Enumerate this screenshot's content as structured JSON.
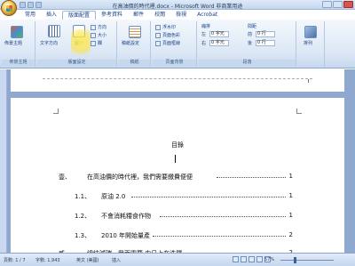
{
  "window": {
    "title": "在高油價的時代裡.docx - Microsoft Word 非商業用途"
  },
  "tabs": [
    {
      "label": "常用"
    },
    {
      "label": "插入"
    },
    {
      "label": "版面配置"
    },
    {
      "label": "參考資料"
    },
    {
      "label": "郵件"
    },
    {
      "label": "校閱"
    },
    {
      "label": "檢視"
    },
    {
      "label": "Acrobat"
    }
  ],
  "ribbon": {
    "theme": {
      "label": "佈景主題",
      "group": "佈景主題"
    },
    "page_setup": {
      "text_direction": "文字方向",
      "margins": "邊界",
      "orientation": "方向",
      "size": "大小",
      "columns": "欄",
      "breaks": "分隔設定",
      "line_numbers": "行號",
      "hyphenation": "斷字",
      "group": "版面設定"
    },
    "draft": {
      "label": "稿紙設定",
      "group": "稿紙"
    },
    "page_background": {
      "watermark": "浮水印",
      "page_color": "頁面色彩",
      "page_borders": "頁面框線",
      "group": "頁面背景"
    },
    "paragraph": {
      "indent": "縮排",
      "spacing": "間距",
      "left_label": "左",
      "right_label": "右",
      "before_label": "前",
      "after_label": "後",
      "left_value": "0 字元",
      "right_value": "0 字元",
      "before_value": "0 行",
      "after_value": "0 行",
      "group": "段落"
    },
    "arrange": {
      "label": "排列"
    }
  },
  "document": {
    "toc_title": "目錄",
    "entries": [
      {
        "num": "壹、",
        "text": "在高油價的時代裡，我們需要繳費便便",
        "page": "1"
      },
      {
        "num": "1.1、",
        "text": "原油 2.0",
        "page": "1"
      },
      {
        "num": "1.2、",
        "text": "不會消耗糧食作物",
        "page": "1"
      },
      {
        "num": "1.3、",
        "text": "2010 年開始量產",
        "page": "2"
      },
      {
        "num": "貳、",
        "text": "總結減碳，我而需要 由日上在洗釋",
        "page": "2"
      }
    ]
  },
  "statusbar": {
    "page": "頁數: 1 / 7",
    "words": "字數: 1,943",
    "language": "英文 (美國)",
    "mode": "插入",
    "zoom": "57%",
    "zoom_level": 0.57
  }
}
